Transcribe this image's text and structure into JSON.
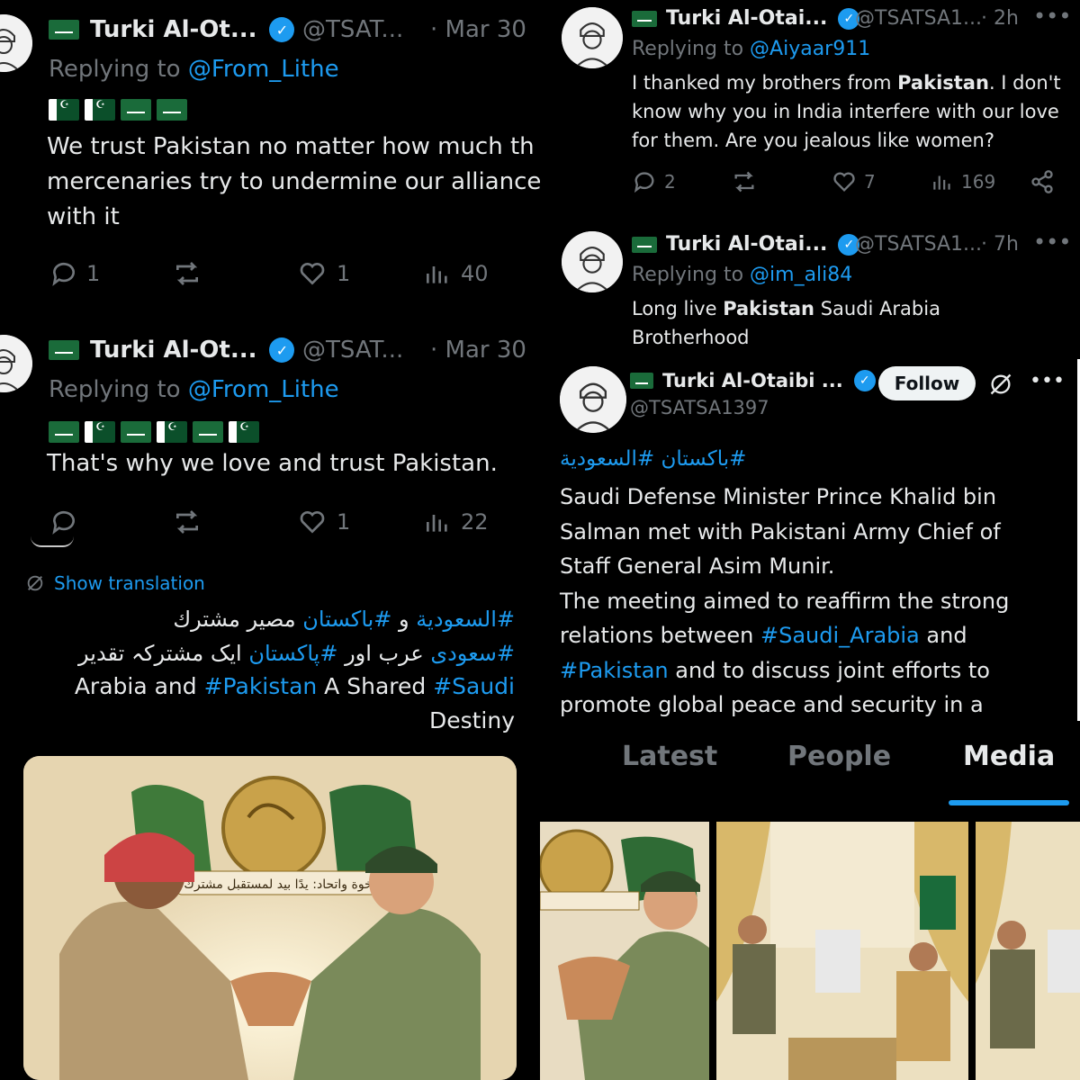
{
  "author": {
    "name": "Turki Al-Ot...",
    "name_mid": "Turki Al-Otai...",
    "name_full": "Turki Al-Otaibi ...",
    "handle_short": "@TSAT...",
    "handle_mid": "@TSATSA1...",
    "handle_full": "@TSATSA1397"
  },
  "tweet1": {
    "time": "· Mar 30",
    "replying_prefix": "Replying to ",
    "replying_to": "@From_Lithe",
    "text": "We trust Pakistan no matter how much th mercenaries try to undermine our alliance with it",
    "replies": "1",
    "likes": "1",
    "views": "40"
  },
  "tweet2": {
    "time": "· Mar 30",
    "replying_prefix": "Replying to ",
    "replying_to": "@From_Lithe",
    "text": "That's why we love and trust Pakistan.",
    "likes": "1",
    "views": "22",
    "show_translation": "Show translation",
    "line1_tag1": "#السعودية",
    "line1_mid": " و ",
    "line1_tag2": "#باكستان",
    "line1_rest": " مصير مشترك",
    "line2_tag1": "#سعودی",
    "line2_mid": " عرب اور ",
    "line2_tag2": "#پاکستان",
    "line2_rest": " ایک مشترکہ تقدیر",
    "line3_a": "Arabia and ",
    "line3_tag": "#Pakistan",
    "line3_b": " A Shared ",
    "line3_tag2": "#Saudi",
    "line4": "Destiny",
    "banner": "أخوة واتحاد: يدًا بيد لمستقبل مشترك"
  },
  "tweet3": {
    "time": "· 2h",
    "replying_prefix": "Replying to ",
    "replying_to": "@Aiyaar911",
    "text_a": "I thanked my brothers from ",
    "text_bold": "Pakistan",
    "text_b": ". I don't know why you in India interfere with our love for them. Are you jealous like women?",
    "replies": "2",
    "likes": "7",
    "views": "169"
  },
  "tweet4": {
    "time": "· 7h",
    "replying_prefix": "Replying to ",
    "replying_to": "@im_ali84",
    "text_a": "Long live ",
    "text_bold": "Pakistan",
    "text_b": " Saudi Arabia Brotherhood"
  },
  "tweet5": {
    "follow": "Follow",
    "hashtags": "#باكستان #السعودية",
    "text_a": "Saudi Defense Minister Prince Khalid bin Salman met with Pakistani Army Chief of Staff General Asim Munir.",
    "text_b": "The meeting aimed to reaffirm the strong relations between ",
    "tag1": "#Saudi_Arabia",
    "text_c": " and ",
    "tag2": "#Pakistan",
    "text_d": " and to discuss joint efforts to promote global peace and security in a way"
  },
  "tabs": {
    "latest": "Latest",
    "people": "People",
    "media": "Media"
  },
  "colors": {
    "accent": "#1d9bf0",
    "muted": "#71767b",
    "text": "#e7e9ea",
    "background": "#000000"
  }
}
